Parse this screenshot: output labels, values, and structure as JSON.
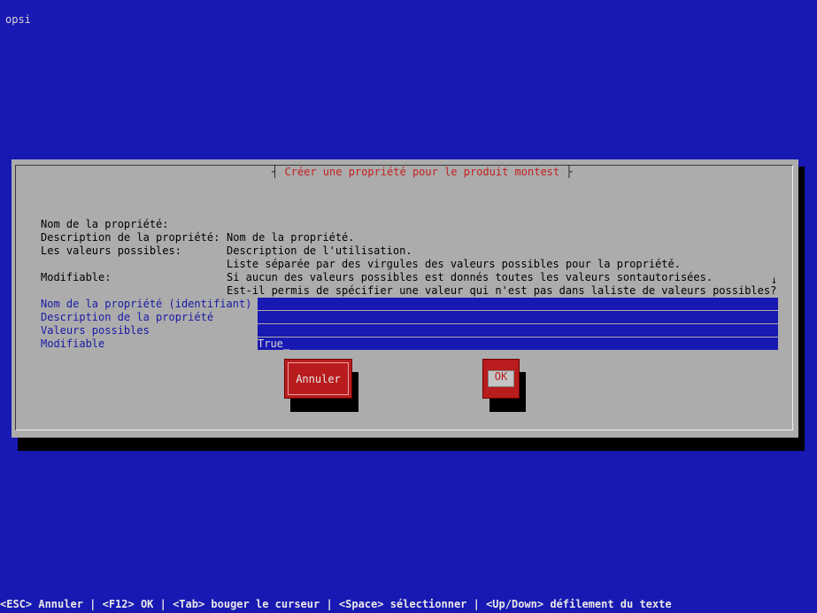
{
  "app": {
    "title": "opsi"
  },
  "dialog": {
    "title": "Créer une propriété pour le produit montest",
    "help": [
      {
        "key": "Nom de la propriété:",
        "value": "Nom de la propriété."
      },
      {
        "key": "Description de la propriété:",
        "value": "Description de l'utilisation."
      },
      {
        "key": "Les valeurs possibles:",
        "value": "Liste séparée par des virgules des valeurs possibles pour la propriété."
      },
      {
        "key": "",
        "value": "Si aucun des valeurs possibles est donnés toutes les valeurs sontautorisées."
      },
      {
        "key": "Modifiable:",
        "value": "Est-il permis de spécifier une valeur qui n'est pas dans laliste de valeurs possibles?"
      }
    ],
    "scroll_indicator": "↓",
    "fields": [
      {
        "label": "Nom de la propriété (identifiant)",
        "value": ""
      },
      {
        "label": "Description de la propriété",
        "value": ""
      },
      {
        "label": "Valeurs possibles",
        "value": ""
      },
      {
        "label": "Modifiable",
        "value": "True_"
      }
    ],
    "buttons": {
      "cancel": "Annuler",
      "ok": "OK"
    },
    "colors": {
      "background": "#acacac",
      "title": "#c42020",
      "field_label": "#1a1aa6",
      "button": "#b81c1c"
    }
  },
  "status_bar": {
    "text": "<ESC> Annuler | <F12> OK | <Tab> bouger le curseur | <Space> sélectionner | <Up/Down> défilement du texte"
  },
  "colors": {
    "screen_background": "#1818b2"
  }
}
